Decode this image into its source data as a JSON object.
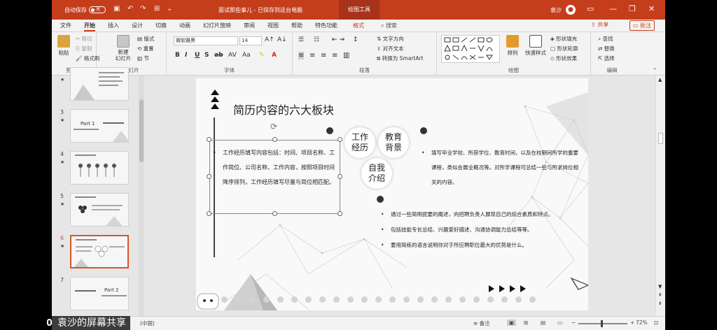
{
  "titlebar": {
    "autosave_label": "自动保存",
    "autosave_state": "关",
    "doc_title": "面试那些事儿 - 已保存到这台电脑",
    "context_tab": "绘图工具",
    "user_name": "袁沙"
  },
  "tabs": [
    "文件",
    "开始",
    "插入",
    "设计",
    "切换",
    "动画",
    "幻灯片放映",
    "审阅",
    "视图",
    "帮助",
    "特色功能",
    "格式"
  ],
  "search_label": "搜索",
  "share_label": "共享",
  "comment_label": "批注",
  "ribbon": {
    "clipboard": {
      "paste": "粘贴",
      "cut": "剪切",
      "copy": "复制",
      "painter": "格式刷",
      "label": "剪贴板"
    },
    "slides": {
      "new": "新建\n幻灯片",
      "layout": "版式",
      "reset": "重置",
      "section": "节",
      "label": "幻灯片"
    },
    "font": {
      "name": "微软雅黑",
      "size": "14",
      "label": "字体"
    },
    "paragraph": {
      "direction": "文字方向",
      "align": "对齐文本",
      "smartart": "转换为 SmartArt",
      "label": "段落"
    },
    "drawing": {
      "arrange": "排列",
      "quick_styles": "快速样式",
      "fill": "形状填充",
      "outline": "形状轮廓",
      "effect": "形状效果",
      "label": "绘图"
    },
    "editing": {
      "find": "查找",
      "replace": "替换",
      "select": "选择",
      "label": "编辑"
    }
  },
  "thumbnails": [
    {
      "num": "",
      "star": "★"
    },
    {
      "num": "3",
      "star": "★",
      "text": "Part 1"
    },
    {
      "num": "4",
      "star": "★"
    },
    {
      "num": "5",
      "star": "★"
    },
    {
      "num": "6",
      "star": "★",
      "selected": true
    },
    {
      "num": "7",
      "star": "",
      "text": "Part 2"
    }
  ],
  "slide": {
    "title": "简历内容的六大板块",
    "work_text": "工作经历填写内容包括：时间、项目名称、工作岗位、公司名称、工作内容，按照项目时间降序排列，工作经历填写尽量与岗位相匹配。",
    "circles": [
      "工作\n经历",
      "教育\n背景",
      "自我\n介绍"
    ],
    "edu_text": "填写毕业学校、所获学位、教育时间，以及在校期间所学的重要课程，类似会展业概况等。对所学课程可总结一些与所求岗位相关的内容。",
    "intro_items": [
      "通过一些简明扼要的概述，向招聘负责人展现自己的综合素质和特点。",
      "包括技能专长总结、兴趣爱好描述、沟通协调能力总结等等。",
      "要用简练的语言说明你对于所应聘职位最大的优势是什么。"
    ]
  },
  "statusbar": {
    "lang": "(中国)",
    "notes": "备注",
    "zoom": "72%"
  },
  "overlay_text": "袁沙的屏幕共享",
  "colors": {
    "accent": "#c43e1c"
  }
}
